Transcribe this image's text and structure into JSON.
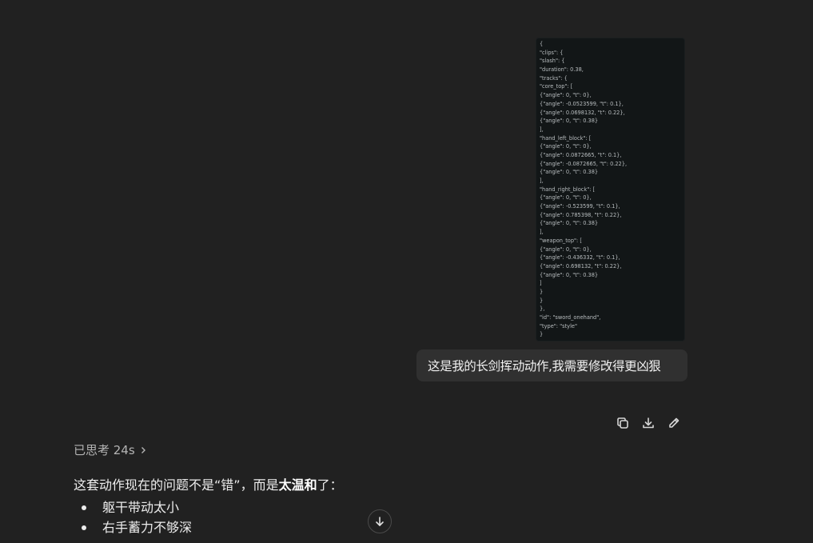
{
  "attachment": {
    "code_lines": [
      "{",
      "\"clips\": {",
      "\"slash\": {",
      "\"duration\": 0.38,",
      "\"tracks\": {",
      "\"core_top\": [",
      "{\"angle\": 0, \"t\": 0},",
      "{\"angle\": -0.0523599, \"t\": 0.1},",
      "{\"angle\": 0.0698132, \"t\": 0.22},",
      "{\"angle\": 0, \"t\": 0.38}",
      "],",
      "\"hand_left_block\": [",
      "{\"angle\": 0, \"t\": 0},",
      "{\"angle\": 0.0872665, \"t\": 0.1},",
      "{\"angle\": -0.0872665, \"t\": 0.22},",
      "{\"angle\": 0, \"t\": 0.38}",
      "],",
      "\"hand_right_block\": [",
      "{\"angle\": 0, \"t\": 0},",
      "{\"angle\": -0.523599, \"t\": 0.1},",
      "{\"angle\": 0.785398, \"t\": 0.22},",
      "{\"angle\": 0, \"t\": 0.38}",
      "],",
      "\"weapon_top\": [",
      "{\"angle\": 0, \"t\": 0},",
      "{\"angle\": -0.436332, \"t\": 0.1},",
      "{\"angle\": 0.698132, \"t\": 0.22},",
      "{\"angle\": 0, \"t\": 0.38}",
      "]",
      "}",
      "}",
      "},",
      "\"id\": \"sword_onehand\",",
      "\"type\": \"style\"",
      "}"
    ]
  },
  "user_message": {
    "text": "这是我的长剑挥动动作,我需要修改得更凶狠"
  },
  "message_actions": [
    {
      "name": "copy",
      "icon": "copy-icon"
    },
    {
      "name": "download",
      "icon": "download-icon"
    },
    {
      "name": "edit",
      "icon": "edit-pencil-icon"
    }
  ],
  "assistant": {
    "thought_label": "已思考 24s",
    "intro_prefix": "这套动作现在的问题不是“错”，而是",
    "intro_bold": "太温和",
    "intro_suffix": "了：",
    "bullets": [
      "躯干带动太小",
      "右手蓄力不够深"
    ]
  },
  "scroll_button": {
    "icon": "arrow-down-icon"
  }
}
